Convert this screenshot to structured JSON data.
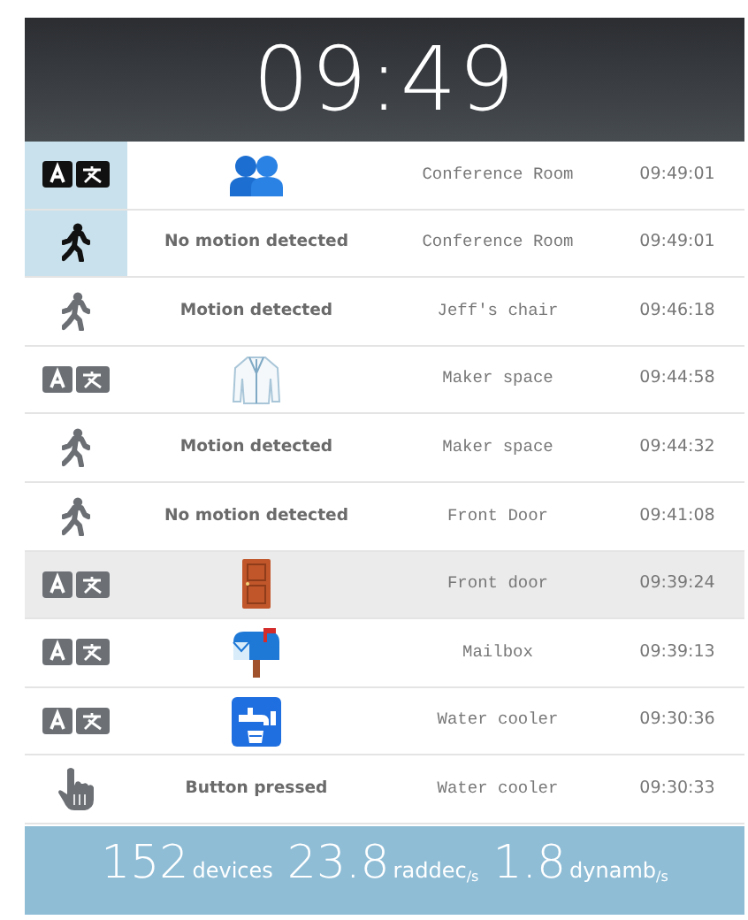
{
  "clock": "09:49",
  "events": [
    {
      "kind": "people",
      "recent": true,
      "shaded": false,
      "location": "Conference Room",
      "time": "09:49:01"
    },
    {
      "kind": "motion",
      "recent": true,
      "shaded": false,
      "label": "No motion detected",
      "location": "Conference Room",
      "time": "09:49:01"
    },
    {
      "kind": "motion",
      "recent": false,
      "shaded": false,
      "label": "Motion detected",
      "location": "Jeff's chair",
      "time": "09:46:18"
    },
    {
      "kind": "coat",
      "recent": false,
      "shaded": false,
      "location": "Maker space",
      "time": "09:44:58"
    },
    {
      "kind": "motion",
      "recent": false,
      "shaded": false,
      "label": "Motion detected",
      "location": "Maker space",
      "time": "09:44:32"
    },
    {
      "kind": "motion",
      "recent": false,
      "shaded": false,
      "label": "No motion detected",
      "location": "Front Door",
      "time": "09:41:08"
    },
    {
      "kind": "door",
      "recent": false,
      "shaded": true,
      "location": "Front door",
      "time": "09:39:24"
    },
    {
      "kind": "mailbox",
      "recent": false,
      "shaded": false,
      "location": "Mailbox",
      "time": "09:39:13"
    },
    {
      "kind": "tap",
      "recent": false,
      "shaded": false,
      "location": "Water cooler",
      "time": "09:30:36"
    },
    {
      "kind": "button",
      "recent": false,
      "shaded": false,
      "label": "Button pressed",
      "location": "Water cooler",
      "time": "09:30:33"
    }
  ],
  "stats": [
    {
      "value": "152",
      "unit": "devices"
    },
    {
      "value": "23.8",
      "unit": "raddec$_{/s}$"
    },
    {
      "value": "1.8",
      "unit": "dynamb$_{/s}$"
    }
  ]
}
